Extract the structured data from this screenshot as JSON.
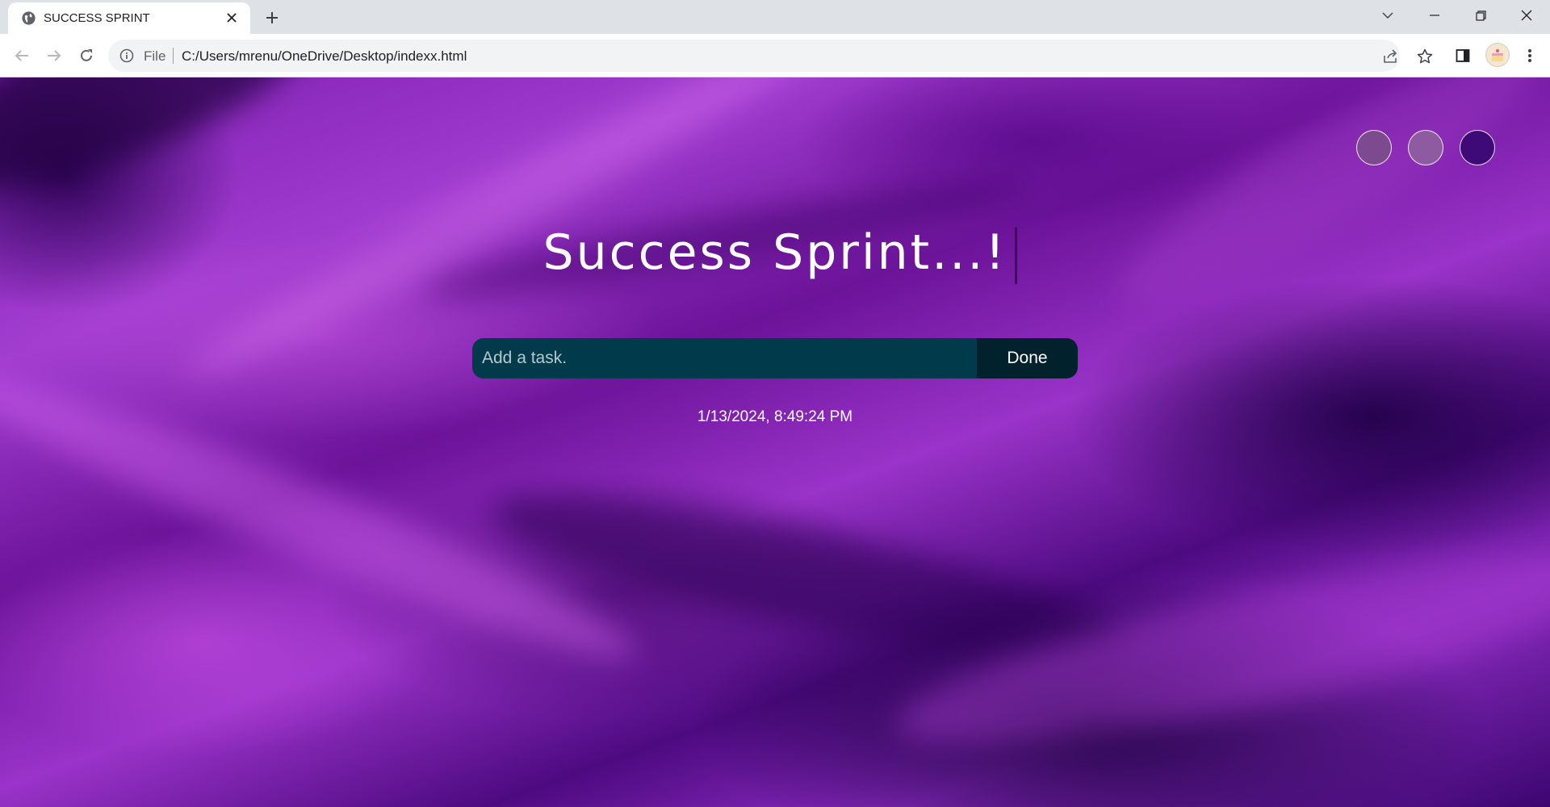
{
  "browser": {
    "tab": {
      "title": "SUCCESS SPRINT",
      "favicon": "globe-icon"
    },
    "window_controls": [
      "chevron-down-icon",
      "minimize-icon",
      "restore-icon",
      "close-icon"
    ],
    "address": {
      "scheme_label": "File",
      "url": "C:/Users/mrenu/OneDrive/Desktop/indexx.html"
    }
  },
  "page": {
    "title": "Success Sprint...!",
    "task_input": {
      "placeholder": "Add a task.",
      "value": ""
    },
    "done_label": "Done",
    "datetime": "1/13/2024, 8:49:24 PM",
    "theme_dots": [
      {
        "color": "#7d4a8f"
      },
      {
        "color": "#8e5aa0"
      },
      {
        "color": "#3d0a78"
      }
    ],
    "colors": {
      "input_bg": "#013a4a",
      "button_bg": "#01222d",
      "accent": "#a13cd0"
    }
  }
}
